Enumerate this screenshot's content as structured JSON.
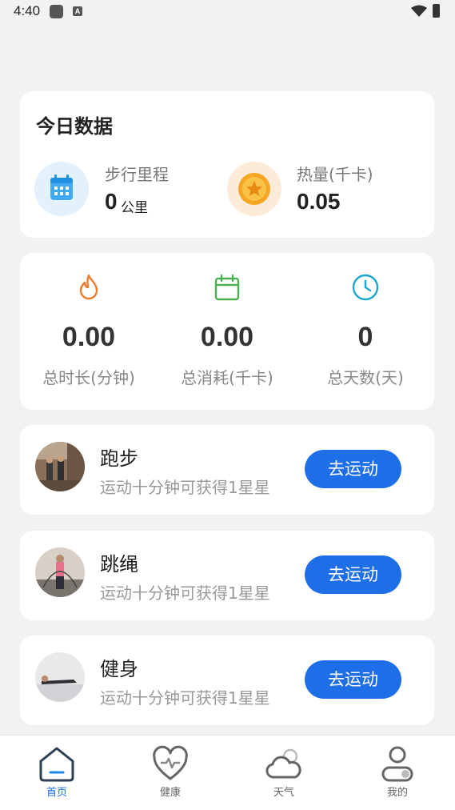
{
  "status_bar": {
    "time": "4:40"
  },
  "today": {
    "title": "今日数据",
    "steps": {
      "label": "步行里程",
      "value": "0",
      "unit": "公里"
    },
    "calories": {
      "label": "热量(千卡)",
      "value": "0.05"
    }
  },
  "totals": [
    {
      "icon": "flame-icon",
      "value": "0.00",
      "label": "总时长(分钟)",
      "color": "#f07a2e"
    },
    {
      "icon": "calendar-icon",
      "value": "0.00",
      "label": "总消耗(千卡)",
      "color": "#4caf50"
    },
    {
      "icon": "clock-icon",
      "value": "0",
      "label": "总天数(天)",
      "color": "#1ba8cf"
    }
  ],
  "exercises": [
    {
      "name": "跑步",
      "desc": "运动十分钟可获得1星星",
      "button": "去运动"
    },
    {
      "name": "跳绳",
      "desc": "运动十分钟可获得1星星",
      "button": "去运动"
    },
    {
      "name": "健身",
      "desc": "运动十分钟可获得1星星",
      "button": "去运动"
    }
  ],
  "tabs": [
    {
      "label": "首页",
      "icon": "home-icon",
      "active": true
    },
    {
      "label": "健康",
      "icon": "heart-pulse-icon",
      "active": false
    },
    {
      "label": "天气",
      "icon": "cloud-icon",
      "active": false
    },
    {
      "label": "我的",
      "icon": "profile-icon",
      "active": false
    }
  ],
  "colors": {
    "accent": "#1e6ee8",
    "background": "#f2f2f2"
  }
}
